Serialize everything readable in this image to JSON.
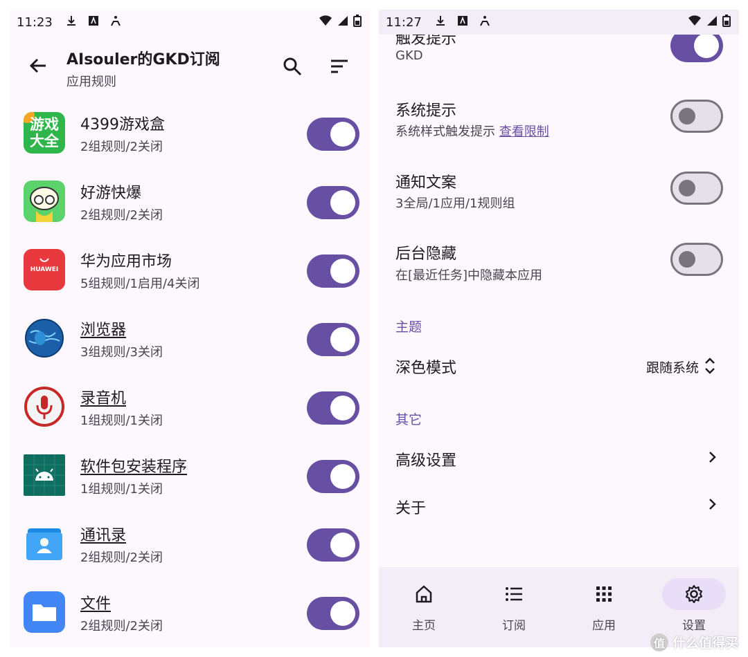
{
  "left": {
    "status_time": "11:23",
    "title": "AIsouler的GKD订阅",
    "subtitle": "应用规则",
    "apps": [
      {
        "name": "4399游戏盒",
        "desc": "2组规则/2关闭"
      },
      {
        "name": "好游快爆",
        "desc": "2组规则/2关闭"
      },
      {
        "name": "华为应用市场",
        "desc": "5组规则/1启用/4关闭"
      },
      {
        "name": "浏览器",
        "desc": "3组规则/3关闭"
      },
      {
        "name": "录音机",
        "desc": "1组规则/1关闭"
      },
      {
        "name": "软件包安装程序",
        "desc": "1组规则/1关闭"
      },
      {
        "name": "通讯录",
        "desc": "2组规则/2关闭"
      },
      {
        "name": "文件",
        "desc": "2组规则/2关闭"
      }
    ],
    "icon_texts": {
      "game_box": "游戏大全",
      "huawei": "HUAWEI"
    }
  },
  "right": {
    "status_time": "11:27",
    "settings": [
      {
        "title": "触发提示",
        "desc": "GKD",
        "toggle": true
      },
      {
        "title": "系统提示",
        "desc": "系统样式触发提示",
        "link": "查看限制",
        "toggle": false
      },
      {
        "title": "通知文案",
        "desc": "3全局/1应用/1规则组",
        "toggle": false
      },
      {
        "title": "后台隐藏",
        "desc": "在[最近任务]中隐藏本应用",
        "toggle": false
      }
    ],
    "theme_section": "主题",
    "dark_mode": {
      "title": "深色模式",
      "value": "跟随系统"
    },
    "other_section": "其它",
    "advanced": "高级设置",
    "about": "关于",
    "nav": [
      {
        "label": "主页",
        "icon": "home-icon"
      },
      {
        "label": "订阅",
        "icon": "list-icon"
      },
      {
        "label": "应用",
        "icon": "apps-grid-icon"
      },
      {
        "label": "设置",
        "icon": "gear-icon"
      }
    ],
    "watermark": "什么值得买",
    "watermark_mark": "值"
  },
  "colors": {
    "accent": "#6750a4",
    "surface": "#fdf7fe",
    "nav_bg": "#f3edf7",
    "active_pill": "#e8def8"
  }
}
